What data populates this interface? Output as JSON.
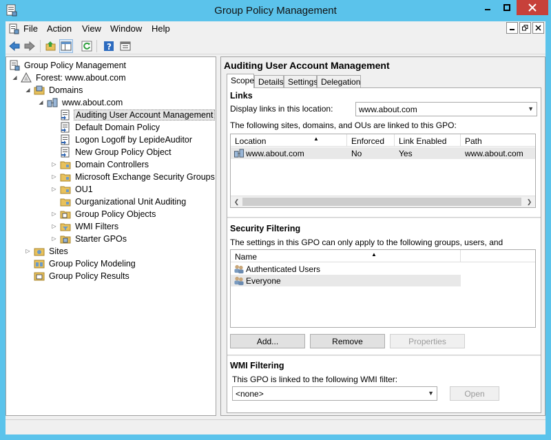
{
  "window": {
    "title": "Group Policy Management"
  },
  "menu": {
    "items": [
      "File",
      "Action",
      "View",
      "Window",
      "Help"
    ]
  },
  "toolbar": {
    "buttons": [
      "back-icon",
      "forward-icon",
      "up-folder-icon",
      "show-hide-tree-icon",
      "refresh-icon",
      "help-icon",
      "properties-icon"
    ]
  },
  "tree": {
    "root": "Group Policy Management",
    "forest": "Forest: www.about.com",
    "domains": "Domains",
    "domain": "www.about.com",
    "items": [
      "Auditing User Account Management",
      "Default Domain Policy",
      "Logon Logoff by LepideAuditor",
      "New Group Policy Object",
      "Domain Controllers",
      "Microsoft Exchange Security Groups",
      "OU1",
      "Ourganizational Unit Auditing",
      "Group Policy Objects",
      "WMI Filters",
      "Starter GPOs"
    ],
    "sites": "Sites",
    "modeling": "Group Policy Modeling",
    "results": "Group Policy Results"
  },
  "detail": {
    "title": "Auditing User Account Management",
    "tabs": [
      "Scope",
      "Details",
      "Settings",
      "Delegation"
    ],
    "links": {
      "heading": "Links",
      "display_label": "Display links in this location:",
      "display_value": "www.about.com",
      "desc": "The following sites, domains, and OUs are linked to this GPO:",
      "columns": [
        "Location",
        "Enforced",
        "Link Enabled",
        "Path"
      ],
      "rows": [
        {
          "location": "www.about.com",
          "enforced": "No",
          "link_enabled": "Yes",
          "path": "www.about.com"
        }
      ]
    },
    "security": {
      "heading": "Security Filtering",
      "desc": "The settings in this GPO can only apply to the following groups, users, and computers:",
      "column": "Name",
      "rows": [
        "Authenticated Users",
        "Everyone"
      ],
      "buttons": {
        "add": "Add...",
        "remove": "Remove",
        "properties": "Properties"
      }
    },
    "wmi": {
      "heading": "WMI Filtering",
      "desc": "This GPO is linked to the following WMI filter:",
      "value": "<none>",
      "open": "Open"
    }
  },
  "colors": {
    "titlebar": "#5bc3eb",
    "close": "#c7413a",
    "selection": "#e5e5e5"
  }
}
